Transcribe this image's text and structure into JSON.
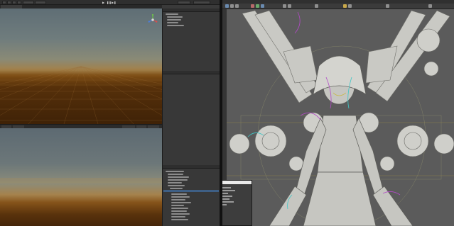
{
  "colors": {
    "unity_bg": "#3a3a3a",
    "maya_viewport": "#5b5b5b",
    "selection_blue": "#3e5f85",
    "model_gray": "#c9c9c4",
    "wire_purple": "#b24ac6",
    "wire_cyan": "#3fc6c6",
    "wire_yellow": "#c9b83a",
    "gizmo_red": "#e14b4b",
    "gizmo_green": "#6cc24a",
    "gizmo_blue": "#4a7ee1"
  },
  "icons": {
    "play": "play-icon",
    "pause": "pause-icon",
    "step": "step-icon"
  },
  "glyphs": {
    "play": "▶",
    "pause": "❚❚",
    "step": "▶❚"
  }
}
